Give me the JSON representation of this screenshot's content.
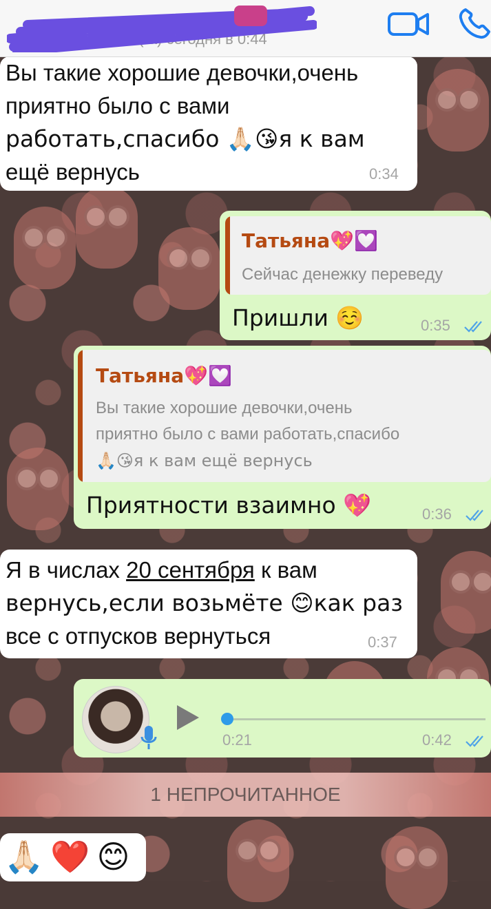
{
  "header": {
    "last_seen": "был(-а) сегодня в 0:44",
    "video_icon": "video-camera-icon",
    "call_icon": "phone-icon",
    "accent": "#1e7ef0"
  },
  "messages": [
    {
      "direction": "incoming",
      "lines": [
        "Вы такие хорошие девочки,очень",
        "приятно было с вами",
        "работать,спасибо 🙏🏻😘я к вам",
        "ещё вернусь"
      ],
      "time": "0:34"
    },
    {
      "direction": "outgoing",
      "quote_name": "Татьяна💖💟",
      "quote_text": [
        "Сейчас денежку переведу"
      ],
      "text": "Пришли ☺️",
      "time": "0:35"
    },
    {
      "direction": "outgoing",
      "quote_name": "Татьяна💖💟",
      "quote_text": [
        "Вы такие хорошие девочки,очень",
        "приятно было с вами работать,спасибо",
        "🙏🏻😘я к вам ещё вернусь"
      ],
      "text": "Приятности взаимно 💖",
      "time": "0:36"
    },
    {
      "direction": "incoming",
      "line1_before": "Я в числах ",
      "line1_link": "20 сентября",
      "line1_after": " к вам",
      "line2": "вернусь,если возьмёте 😊как раз",
      "line3": "все с отпусков вернуться",
      "time": "0:37"
    },
    {
      "direction": "outgoing",
      "type": "voice",
      "duration": "0:21",
      "time": "0:42",
      "progress": 0.0
    }
  ],
  "unread_banner": "1 НЕПРОЧИТАННОЕ",
  "last_message": {
    "direction": "incoming",
    "text": "🙏🏻❤️😊"
  },
  "colors": {
    "incoming_bubble": "#ffffff",
    "outgoing_bubble": "#dcf8c6",
    "quote_name": "#b54a12",
    "read_ticks": "#4fa3e8"
  }
}
